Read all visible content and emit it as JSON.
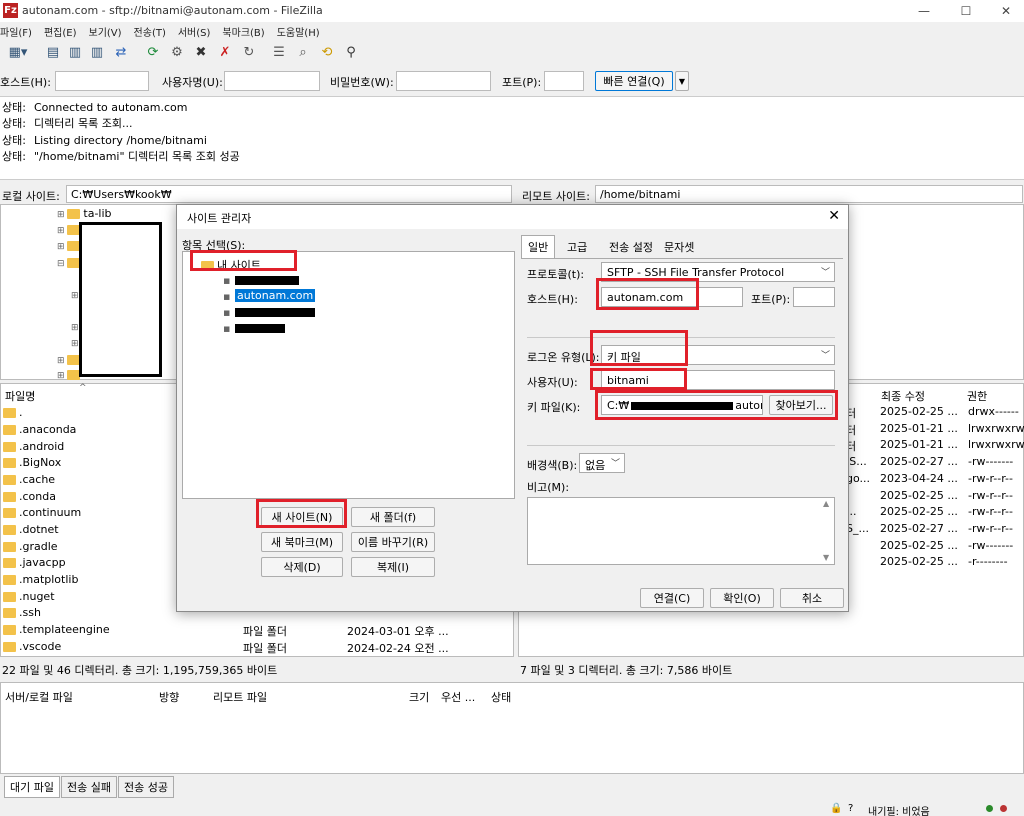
{
  "window": {
    "title": "autonam.com - sftp://bitnami@autonam.com - FileZilla",
    "app_icon": "Fz"
  },
  "menu": [
    "파일(F)",
    "편집(E)",
    "보기(V)",
    "전송(T)",
    "서버(S)",
    "북마크(B)",
    "도움말(H)"
  ],
  "quickconnect": {
    "host_label": "호스트(H):",
    "user_label": "사용자명(U):",
    "pass_label": "비밀번호(W):",
    "port_label": "포트(P):",
    "connect_label": "빠른 연결(Q)",
    "dropdown": "▼"
  },
  "log": [
    {
      "k": "상태:",
      "v": "Connected to autonam.com"
    },
    {
      "k": "상태:",
      "v": "디렉터리 목록 조회..."
    },
    {
      "k": "상태:",
      "v": "Listing directory /home/bitnami"
    },
    {
      "k": "상태:",
      "v": "\"/home/bitnami\" 디렉터리 목록 조회 성공"
    }
  ],
  "local": {
    "path_label": "로컬 사이트:",
    "path": "C:₩Users₩kook₩",
    "tree_first": "ta-lib",
    "col_filename": "파일명",
    "files": [
      ".",
      ".anaconda",
      ".android",
      ".BigNox",
      ".cache",
      ".conda",
      ".continuum",
      ".dotnet",
      ".gradle",
      ".javacpp",
      ".matplotlib",
      ".nuget",
      ".ssh",
      ".templateengine",
      ".vscode"
    ],
    "rows_partial": [
      {
        "name": ".templateengine",
        "type": "파일 폴더",
        "date": "2024-03-01 오후 ..."
      },
      {
        "name": ".vscode",
        "type": "파일 폴더",
        "date": "2024-02-24 오전 ..."
      }
    ],
    "status": "22 파일 및 46 디렉터리. 총 크기: 1,195,759,365 바이트"
  },
  "remote": {
    "path_label": "리모트 사이트:",
    "path": "/home/bitnami",
    "col_modified": "최종 수정",
    "col_perm": "권한",
    "rows": [
      {
        "type": "터",
        "date": "2025-02-25 ...",
        "perm": "drwx------"
      },
      {
        "type": "터",
        "date": "2025-01-21 ...",
        "perm": "lrwxrwxrwx"
      },
      {
        "type": "터",
        "date": "2025-01-21 ...",
        "perm": "lrwxrwxrwx"
      },
      {
        "type": "IS...",
        "date": "2025-02-27 ...",
        "perm": "-rw-------"
      },
      {
        "type": "go...",
        "date": "2023-04-24 ...",
        "perm": "-rw-r--r--"
      },
      {
        "type": "",
        "date": "2025-02-25 ...",
        "perm": "-rw-r--r--"
      },
      {
        "type": "...",
        "date": "2025-02-25 ...",
        "perm": "-rw-r--r--"
      },
      {
        "type": "S_...",
        "date": "2025-02-27 ...",
        "perm": "-rw-r--r--"
      },
      {
        "type": "",
        "date": "2025-02-25 ...",
        "perm": "-rw-------"
      },
      {
        "type": "",
        "date": "2025-02-25 ...",
        "perm": "-r--------"
      }
    ],
    "status": "7 파일 및 3 디렉터리. 총 크기: 7,586 바이트"
  },
  "queue": {
    "cols": [
      "서버/로컬 파일",
      "방향",
      "리모트 파일",
      "크기",
      "우선 ...",
      "상태"
    ],
    "tabs": [
      "대기 파일",
      "전송 실패",
      "전송 성공"
    ],
    "tray_text": "내기필: 비었음"
  },
  "dialog": {
    "title": "사이트 관리자",
    "select_label": "항목 선택(S):",
    "root": "내 사이트",
    "site_selected": "autonam.com",
    "buttons": {
      "new_site": "새 사이트(N)",
      "new_folder": "새 폴더(f)",
      "new_bookmark": "새 북마크(M)",
      "rename": "이름 바꾸기(R)",
      "delete": "삭제(D)",
      "duplicate": "복제(I)",
      "connect": "연결(C)",
      "ok": "확인(O)",
      "cancel": "취소"
    },
    "tabs": [
      "일반",
      "고급",
      "전송 설정",
      "문자셋"
    ],
    "protocol_label": "프로토콜(t):",
    "protocol": "SFTP - SSH File Transfer Protocol",
    "host_label": "호스트(H):",
    "host": "autonam.com",
    "port_label": "포트(P):",
    "logon_label": "로그온 유형(L):",
    "logon": "키 파일",
    "user_label": "사용자(U):",
    "user": "bitnami",
    "keyfile_label": "키 파일(K):",
    "keyfile_prefix": "C:₩",
    "keyfile_suffix": "autonar",
    "browse": "찾아보기...",
    "bgcolor_label": "배경색(B):",
    "bgcolor": "없음",
    "comment_label": "비고(M):"
  },
  "colors": {
    "highlight": "#e0202a",
    "selection": "#0078d7",
    "folder": "#f3c24a"
  }
}
